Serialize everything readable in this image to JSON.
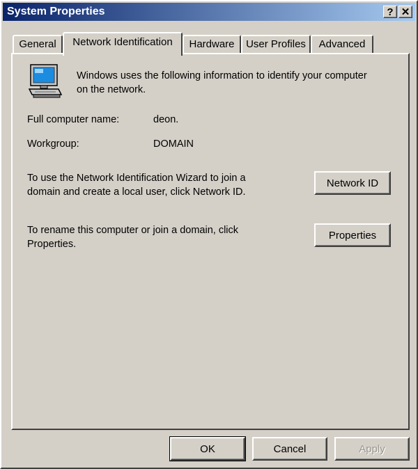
{
  "window": {
    "title": "System Properties",
    "help_label": "?",
    "close_label": "✕"
  },
  "tabs": [
    {
      "label": "General",
      "active": false
    },
    {
      "label": "Network Identification",
      "active": true
    },
    {
      "label": "Hardware",
      "active": false
    },
    {
      "label": "User Profiles",
      "active": false
    },
    {
      "label": "Advanced",
      "active": false
    }
  ],
  "panel": {
    "intro_line1": "Windows uses the following information to identify your computer",
    "intro_line2": "on the network.",
    "full_name_label": "Full computer name:",
    "full_name_value": "deon.",
    "workgroup_label": "Workgroup:",
    "workgroup_value": "DOMAIN",
    "wizard_line1": "To use the Network Identification Wizard to join a",
    "wizard_line2": "domain and create a local user, click Network ID.",
    "network_id_label": "Network ID",
    "rename_line1": "To rename this computer or join a domain, click",
    "rename_line2": "Properties.",
    "properties_label": "Properties"
  },
  "footer": {
    "ok_label": "OK",
    "cancel_label": "Cancel",
    "apply_label": "Apply"
  },
  "icons": {
    "computer": "computer-icon",
    "help": "help-icon",
    "close": "close-icon"
  },
  "colors": {
    "title_start": "#0a246a",
    "title_end": "#a6caf0",
    "face": "#d4d0c8"
  }
}
